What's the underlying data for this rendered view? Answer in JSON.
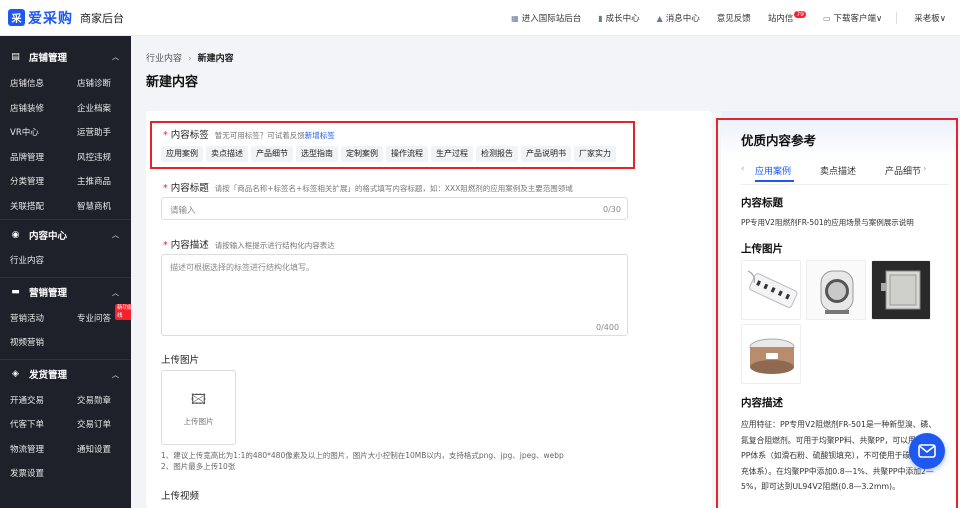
{
  "app": {
    "logo_mark": "采",
    "logo_text": "爱采购",
    "subtitle": "商家后台"
  },
  "topnav": [
    {
      "icon": "grid-icon",
      "label": "进入国际站后台"
    },
    {
      "icon": "growth-icon",
      "label": "成长中心"
    },
    {
      "icon": "bell-icon",
      "label": "消息中心"
    },
    {
      "icon": "",
      "label": "意见反馈"
    },
    {
      "icon": "",
      "label": "站内信",
      "badge": "79"
    },
    {
      "icon": "monitor-icon",
      "label": "下载客户端∨"
    },
    {
      "icon": "",
      "label": "采老板∨"
    }
  ],
  "sidebar": {
    "sections": [
      {
        "title": "店铺管理",
        "icon": "store-icon",
        "items": [
          "店铺信息",
          "店铺诊断",
          "店铺装修",
          "企业档案",
          "VR中心",
          "运营助手",
          "品牌管理",
          "风控违规",
          "分类管理",
          "主推商品",
          "关联搭配",
          "智慧商机"
        ]
      },
      {
        "title": "内容中心",
        "icon": "content-icon",
        "items": [
          "行业内容"
        ]
      },
      {
        "title": "营销管理",
        "icon": "marketing-icon",
        "items": [
          "营销活动",
          "专业问答",
          "视频营销"
        ],
        "new_tag": "新功能上线"
      },
      {
        "title": "发货管理",
        "icon": "delivery-icon",
        "items": [
          "开通交易",
          "交易勋章",
          "代客下单",
          "交易订单",
          "物流管理",
          "通知设置",
          "发票设置"
        ]
      }
    ]
  },
  "breadcrumb": {
    "parent": "行业内容",
    "current": "新建内容"
  },
  "page_title": "新建内容",
  "form": {
    "tags": {
      "label": "内容标签",
      "hint": "暂无可用标签？可试着反馈",
      "hint_link": "新增标签",
      "options": [
        "应用案例",
        "卖点描述",
        "产品细节",
        "选型指南",
        "定制案例",
        "操作流程",
        "生产过程",
        "检测报告",
        "产品说明书",
        "厂家实力"
      ]
    },
    "title": {
      "label": "内容标题",
      "hint": "请按「商品名称+标签名+标签相关扩展」的格式填写内容标题，如：XXX阻燃剂的应用案例及主要范围领域",
      "placeholder": "请输入",
      "counter": "0/30"
    },
    "desc": {
      "label": "内容描述",
      "hint": "请按输入框提示进行结构化内容表达",
      "placeholder": "描述可根据选择的标签进行结构化填写。",
      "counter": "0/400"
    },
    "upload_image": {
      "label": "上传图片",
      "button": "上传图片",
      "notes": [
        "1、建议上传宽高比为1:1的480*480像素及以上的图片，图片大小控制在10MB以内，支持格式png、jpg、jpeg、webp",
        "2、图片最多上传10张"
      ]
    },
    "upload_video": {
      "label": "上传视频"
    }
  },
  "reference": {
    "title": "优质内容参考",
    "tabs": [
      "应用案例",
      "卖点描述",
      "产品细节"
    ],
    "active_tab": "应用案例",
    "content_title_label": "内容标题",
    "content_title": "PP专用V2阻燃剂FR-501的应用场景与案例展示说明",
    "images_label": "上传图片",
    "images": [
      "power-strip-image",
      "heater-image",
      "electrical-box-image",
      "rice-cooker-image"
    ],
    "desc_label": "内容描述",
    "desc": "应用特征：PP专用V2阻燃剂FR-501是一种新型溴、磷、氮复合阻燃剂。可用于均聚PP料、共聚PP，可以用于填充PP体系（如滑石粉、硫酸钡填充），不可使用于碳酸钙填充体系）。在均聚PP中添加0.8—1%、共聚PP中添加2—5%，即可达到UL94V2阻燃(0.8—3.2mm)。"
  },
  "colors": {
    "accent": "#1d58f0",
    "highlight": "#e3242b",
    "sidebar_bg": "#1e2129"
  }
}
